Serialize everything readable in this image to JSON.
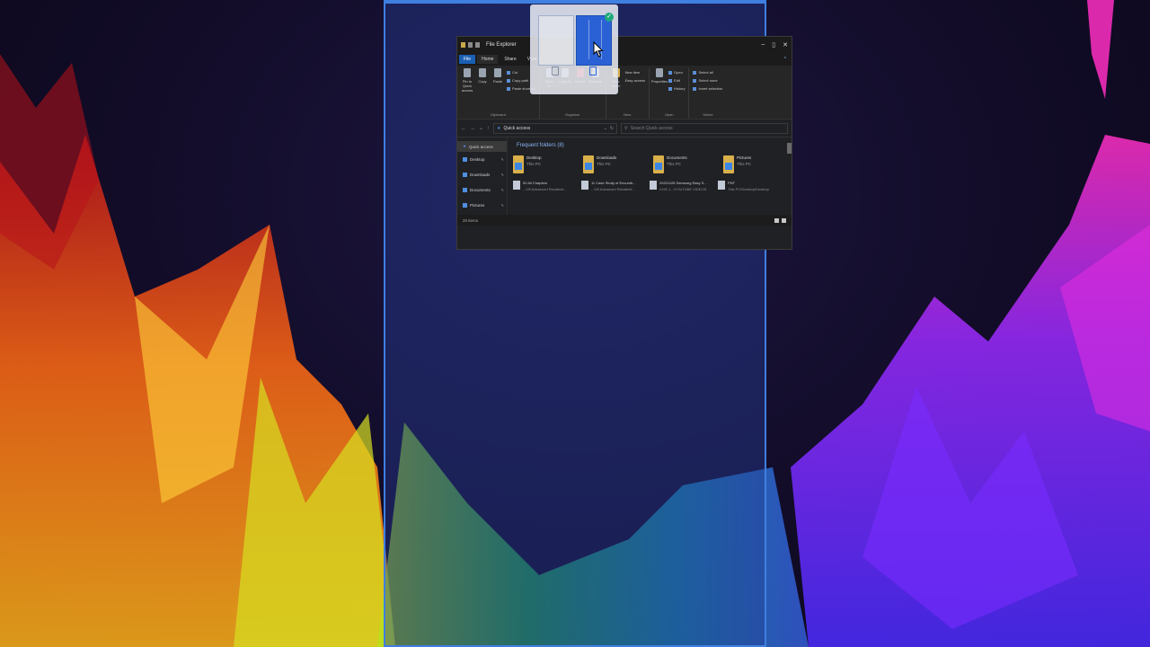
{
  "explorer": {
    "title": "File Explorer",
    "tabs": [
      "File",
      "Home",
      "Share",
      "View"
    ],
    "ribbon": {
      "clipboard": {
        "label": "Clipboard",
        "pin": "Pin to Quick access",
        "copy": "Copy",
        "paste": "Paste",
        "cut": "Cut",
        "copy_path": "Copy path",
        "paste_shortcut": "Paste shortcut"
      },
      "organize": {
        "label": "Organize",
        "move_to": "Move to",
        "copy_to": "Copy to",
        "delete": "Delete",
        "rename": "Rename"
      },
      "new": {
        "label": "New",
        "new_folder": "New folder",
        "new_item": "New item",
        "easy_access": "Easy access"
      },
      "open": {
        "label": "Open",
        "properties": "Properties",
        "open": "Open",
        "edit": "Edit",
        "history": "History"
      },
      "select": {
        "label": "Select",
        "select_all": "Select all",
        "select_none": "Select none",
        "invert": "Invert selection"
      }
    },
    "address": "Quick access",
    "search_placeholder": "Search Quick access",
    "nav": {
      "quick_access": "Quick access",
      "items": [
        "Desktop",
        "Downloads",
        "Documents",
        "Pictures"
      ]
    },
    "section_title": "Frequent folders (8)",
    "folders": [
      {
        "name": "Desktop",
        "location": "This PC"
      },
      {
        "name": "Downloads",
        "location": "This PC"
      },
      {
        "name": "Documents",
        "location": "This PC"
      },
      {
        "name": "Pictures",
        "location": "This PC"
      }
    ],
    "recent": [
      {
        "name": "00 All Chapters",
        "location": "...\\09 Advanced Residenti..."
      },
      {
        "name": "11 Case Study of Encumb...",
        "location": "...\\09 Advanced Residenti..."
      },
      {
        "name": "20221128 Samsung Easy S...",
        "location": "\\\\192.1...\\YOUTUBE VIDEOS"
      },
      {
        "name": "PDF",
        "location": "This PC\\Desktop\\Desktop"
      }
    ],
    "status": "20 items"
  },
  "colors": {
    "snap_overlay": "#3f7fe0",
    "accent": "#1a5fb4",
    "check": "#1faa7a"
  },
  "icons": [
    "maximize-icon",
    "minimize-icon",
    "close-icon",
    "check-icon",
    "cursor-icon"
  ]
}
